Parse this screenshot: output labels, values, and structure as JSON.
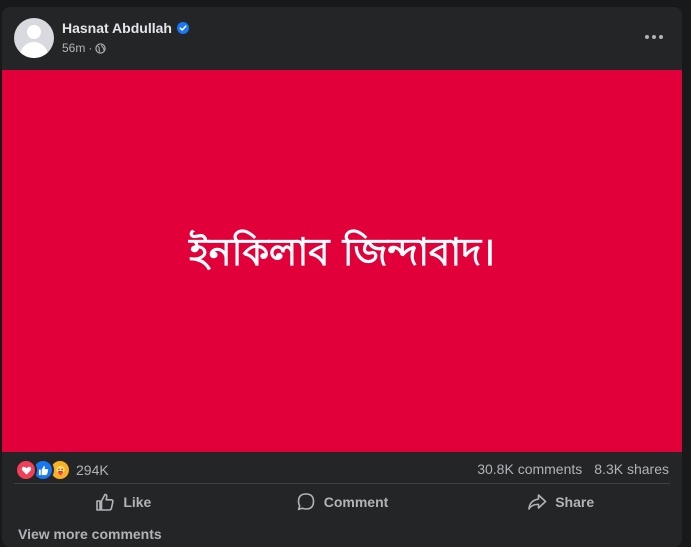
{
  "post": {
    "author": "Hasnat Abdullah",
    "time": "56m",
    "separator": "·",
    "image_text": "ইনকিলাব জিন্দাবাদ।",
    "image_bg": "#e2003b"
  },
  "stats": {
    "reactions_count": "294K",
    "comments": "30.8K comments",
    "shares": "8.3K shares",
    "reaction_types": [
      "love-icon",
      "like-icon",
      "care-icon"
    ]
  },
  "actions": {
    "like": "Like",
    "comment": "Comment",
    "share": "Share"
  },
  "footer": {
    "view_more": "View more comments"
  }
}
